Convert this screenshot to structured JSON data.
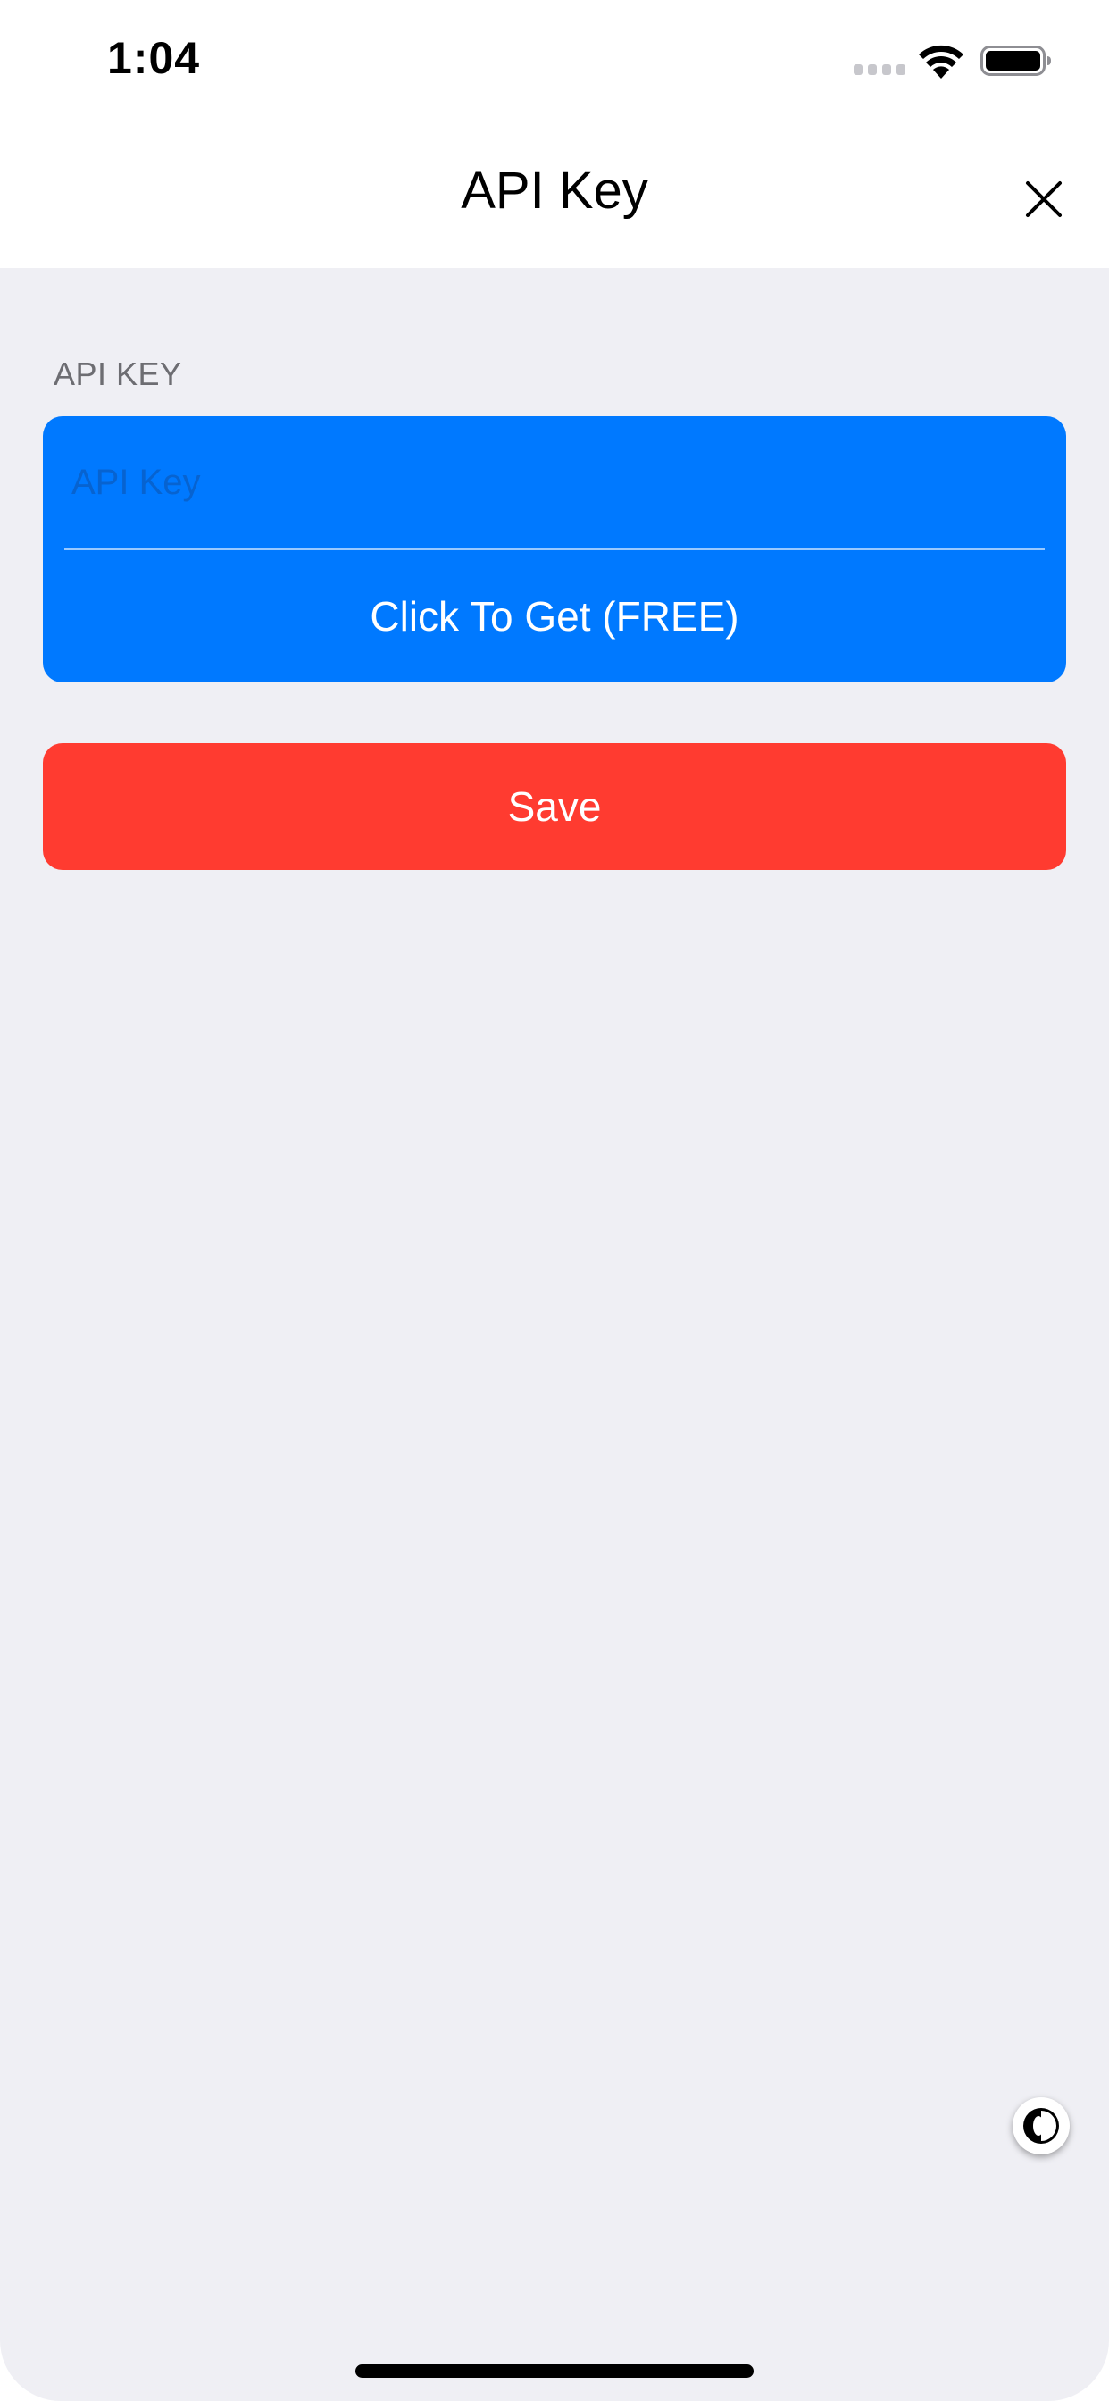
{
  "status_bar": {
    "time": "1:04"
  },
  "nav": {
    "title": "API Key",
    "close_icon": "close-icon"
  },
  "form": {
    "section_header": "API KEY",
    "api_key_value": "",
    "api_key_placeholder": "API Key",
    "get_key_label": "Click To Get (FREE)",
    "save_label": "Save"
  },
  "colors": {
    "background": "#efeff4",
    "card_blue": "#0079ff",
    "save_red": "#ff3b30",
    "section_header_gray": "#6d6d72"
  },
  "icons": {
    "status": [
      "signal-icon",
      "wifi-icon",
      "battery-icon"
    ],
    "floating": "contrast-icon"
  }
}
